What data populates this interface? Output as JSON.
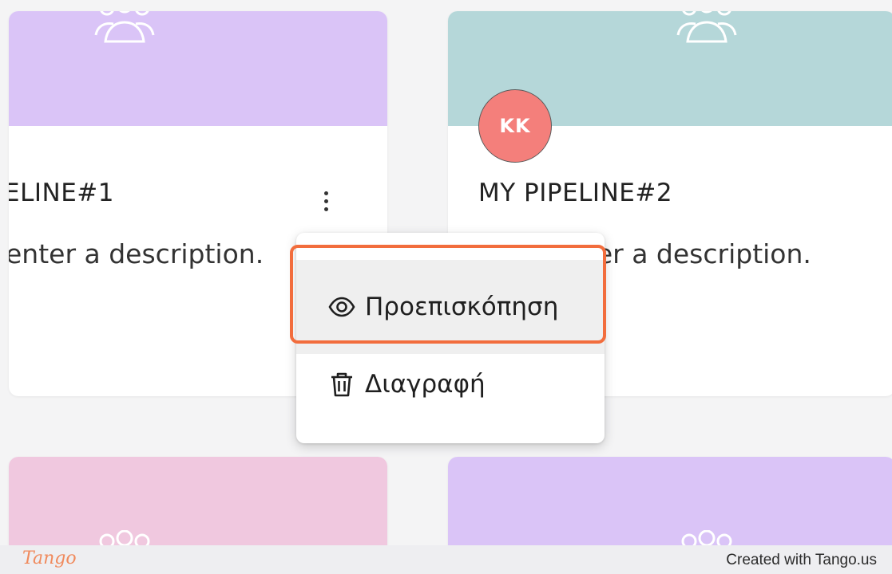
{
  "colors": {
    "cover_purple": "#dac4f7",
    "cover_teal": "#b5d7d9",
    "cover_pink": "#f0c8df",
    "avatar_bg": "#f47f7b",
    "highlight": "#f26d3d",
    "tango_brand": "#f08a5d"
  },
  "cards": [
    {
      "title": "ELINE#1",
      "description": "enter a description.",
      "cover_icon": "group-icon"
    },
    {
      "title": "MY PIPELINE#2",
      "description": "nter a description.",
      "avatar_initials": "KK",
      "cover_icon": "group-icon"
    },
    {
      "cover_icon": "group-icon"
    },
    {
      "cover_icon": "group-icon"
    }
  ],
  "context_menu": {
    "items": [
      {
        "label": "Προεπισκόπηση",
        "icon": "eye-icon",
        "highlighted": true
      },
      {
        "label": "Διαγραφή",
        "icon": "trash-icon"
      }
    ]
  },
  "footer": {
    "logo": "Tango",
    "credit": "Created with Tango.us"
  }
}
